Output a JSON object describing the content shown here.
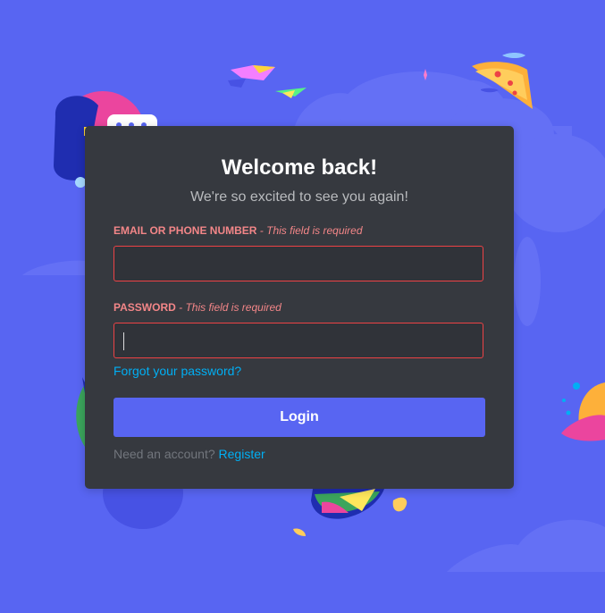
{
  "login": {
    "title": "Welcome back!",
    "subtitle": "We're so excited to see you again!",
    "email": {
      "label": "EMAIL OR PHONE NUMBER",
      "error": "- This field is required",
      "value": ""
    },
    "password": {
      "label": "PASSWORD",
      "error": "- This field is required",
      "value": ""
    },
    "forgot_password": "Forgot your password?",
    "login_button": "Login",
    "need_account": "Need an account?",
    "register_link": "Register"
  },
  "colors": {
    "background": "#5865f2",
    "card": "#36393f",
    "input_bg": "#303339",
    "error": "#f38688",
    "error_border": "#ed4245",
    "link": "#00aff4",
    "button": "#5865f2"
  },
  "icons": [
    "decorative-paper-plane-icon",
    "decorative-bird-icon",
    "decorative-pizza-icon",
    "decorative-fish-icon",
    "decorative-character-icon",
    "decorative-sandwich-icon",
    "decorative-tongue-icon",
    "decorative-cloud-shape"
  ]
}
